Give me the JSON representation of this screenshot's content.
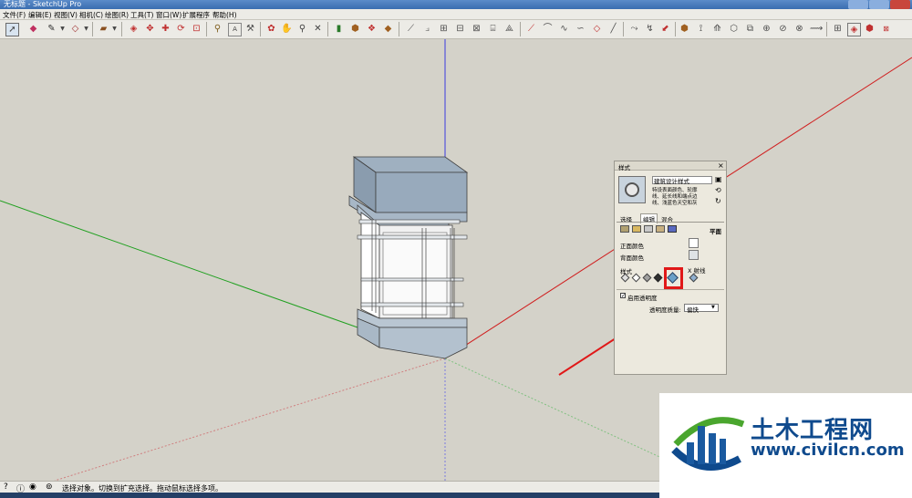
{
  "window": {
    "title": "无标题 - SketchUp Pro"
  },
  "menubar": {
    "items": [
      "文件(F)",
      "编辑(E)",
      "视图(V)",
      "相机(C)",
      "绘图(R)",
      "工具(T)",
      "窗口(W)",
      "扩展程序",
      "帮助(H)"
    ]
  },
  "styles_panel": {
    "title": "样式",
    "close": "×",
    "style_name": "建筑设计样式",
    "style_desc_lines": [
      "特设表面颜色、轮廓",
      "线、延长线和端点边",
      "线、浅蓝色天空和灰"
    ],
    "tabs": [
      "选择",
      "编辑",
      "混合"
    ],
    "view_label": "平面",
    "front_color_label": "正面颜色",
    "back_color_label": "背面颜色",
    "style_section_label": "样式",
    "xray_label": "X 射线",
    "transparency_checkbox_label": "启用透明度",
    "transparency_quality_label": "透明度质量:",
    "transparency_quality_value": "偏快"
  },
  "status": {
    "text": "选择对象。切换到扩充选择。拖动鼠标选择多项。"
  },
  "watermark": {
    "name": "土木工程网",
    "url": "www.civilcn.com"
  },
  "colors": {
    "viewport_bg": "#d4d2c9",
    "blue_axis": "#3a3ae0",
    "red_axis": "#d02020",
    "green_axis": "#20a020",
    "highlight_red": "#e01818",
    "watermark_blue": "#0f4a8d",
    "watermark_green": "#4aa62e"
  }
}
